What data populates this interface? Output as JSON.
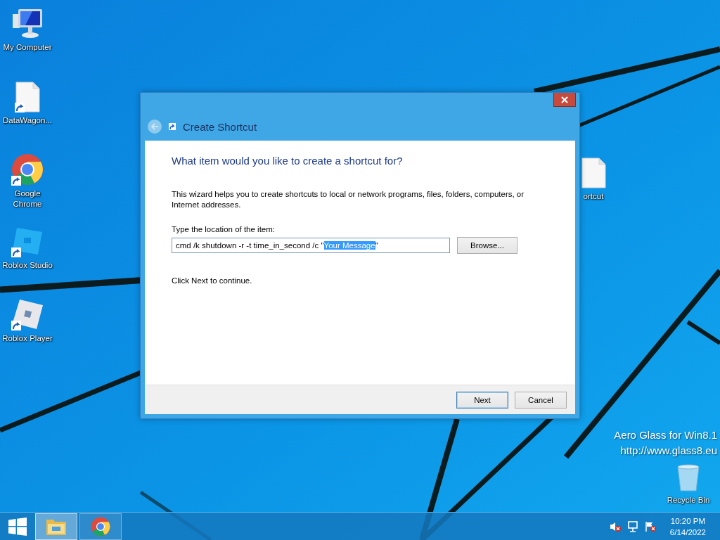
{
  "desktop_icons": [
    {
      "label": "My Computer",
      "kind": "computer",
      "shortcut": false
    },
    {
      "label": "DataWagon...",
      "kind": "document",
      "shortcut": true
    },
    {
      "label": "Google Chrome",
      "kind": "chrome",
      "shortcut": true
    },
    {
      "label": "Roblox Studio",
      "kind": "studio",
      "shortcut": true
    },
    {
      "label": "Roblox Player",
      "kind": "player",
      "shortcut": true
    },
    {
      "label": "ortcut",
      "kind": "document",
      "shortcut": false
    },
    {
      "label": "Recycle Bin",
      "kind": "recycle",
      "shortcut": false
    }
  ],
  "desktop_overlay_text": [
    "Aero Glass for Win8.1",
    "http://www.glass8.eu"
  ],
  "dialog": {
    "title": "Create Shortcut",
    "back_button": {
      "disabled": true
    },
    "heading": "What item would you like to create a shortcut for?",
    "description": "This wizard helps you to create shortcuts to local or network programs, files, folders, computers, or Internet addresses.",
    "location_label": "Type the location of the item:",
    "location_field": {
      "parts": [
        {
          "text": "cmd /k shutdown -r -t time_in_second /c \"",
          "selected": false
        },
        {
          "text": "Your Message",
          "selected": true
        },
        {
          "text": "\"",
          "selected": false
        }
      ]
    },
    "browse_button": "Browse...",
    "hint": "Click Next to continue.",
    "buttons": [
      {
        "label": "Next",
        "default": true
      },
      {
        "label": "Cancel",
        "default": false
      }
    ]
  },
  "taskbar": {
    "pinned": [
      {
        "kind": "explorer",
        "active": true
      },
      {
        "kind": "chrome",
        "active": false
      }
    ],
    "tray_icons": [
      {
        "kind": "speaker-muted"
      },
      {
        "kind": "network"
      },
      {
        "kind": "flag-error"
      }
    ],
    "clock": {
      "time": "10:20 PM",
      "date": "6/14/2022"
    }
  }
}
